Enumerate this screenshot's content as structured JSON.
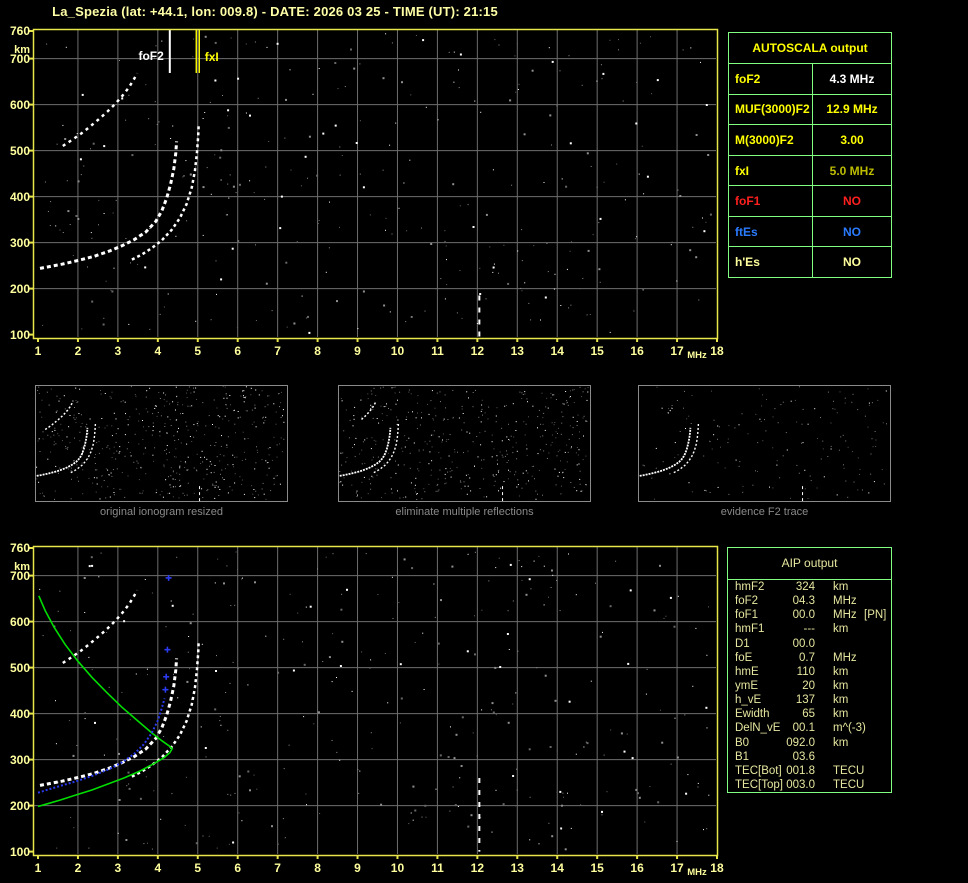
{
  "title": "La_Spezia (lat: +44.1, lon: 009.8) - DATE: 2026 03 25 - TIME (UT): 21:15",
  "colors": {
    "background": "#000000",
    "plot_border": "#e8e64a",
    "grid": "#6e6e6e",
    "axis_text": "#ffff9e",
    "table_border": "#80ff80",
    "trace_white": "#ffffff",
    "model_trace_blue": "#2b3bf0",
    "profile_green": "#00dd00",
    "caption_gray": "#8a8a8a"
  },
  "axes": {
    "x_ticks": [
      "1",
      "2",
      "3",
      "4",
      "5",
      "6",
      "7",
      "8",
      "9",
      "10",
      "11",
      "12",
      "13",
      "14",
      "15",
      "16",
      "17",
      "18"
    ],
    "x_unit": "MHz",
    "y_ticks": [
      "760",
      "700",
      "600",
      "500",
      "400",
      "300",
      "200",
      "100"
    ],
    "y_tick_values": [
      760,
      700,
      600,
      500,
      400,
      300,
      200,
      100
    ],
    "y_unit": "km"
  },
  "autoscala": {
    "header": "AUTOSCALA output",
    "rows": [
      {
        "label": "foF2",
        "value": "4.3 MHz",
        "label_color": "#ffff00",
        "value_color": "#ffffff"
      },
      {
        "label": "MUF(3000)F2",
        "value": "12.9 MHz",
        "label_color": "#ffff00",
        "value_color": "#ffff00"
      },
      {
        "label": "M(3000)F2",
        "value": "3.00",
        "label_color": "#ffff00",
        "value_color": "#ffff00"
      },
      {
        "label": "fxI",
        "value": "5.0 MHz",
        "label_color": "#ffff00",
        "value_color": "#bdbd00"
      },
      {
        "label": "foF1",
        "value": "NO",
        "label_color": "#ff2020",
        "value_color": "#ff2020"
      },
      {
        "label": "ftEs",
        "value": "NO",
        "label_color": "#2b7bff",
        "value_color": "#2b7bff"
      },
      {
        "label": "h'Es",
        "value": "NO",
        "label_color": "#ffff9e",
        "value_color": "#ffff9e"
      }
    ]
  },
  "aip": {
    "header": "AIP output",
    "rows": [
      {
        "label": "hmF2",
        "value": "324",
        "unit": "km",
        "note": ""
      },
      {
        "label": "foF2",
        "value": "04.3",
        "unit": "MHz",
        "note": ""
      },
      {
        "label": "foF1",
        "value": "00.0",
        "unit": "MHz",
        "note": "[PN]"
      },
      {
        "label": "hmF1",
        "value": "---",
        "unit": "km",
        "note": ""
      },
      {
        "label": "D1",
        "value": "00.0",
        "unit": "",
        "note": ""
      },
      {
        "label": "foE",
        "value": "0.7",
        "unit": "MHz",
        "note": ""
      },
      {
        "label": "hmE",
        "value": "110",
        "unit": "km",
        "note": ""
      },
      {
        "label": "ymE",
        "value": "20",
        "unit": "km",
        "note": ""
      },
      {
        "label": "h_vE",
        "value": "137",
        "unit": "km",
        "note": ""
      },
      {
        "label": "Ewidth",
        "value": "65",
        "unit": "km",
        "note": ""
      },
      {
        "label": "DelN_vE",
        "value": "00.1",
        "unit": "m^(-3)",
        "note": ""
      },
      {
        "label": "B0",
        "value": "092.0",
        "unit": "km",
        "note": ""
      },
      {
        "label": "B1",
        "value": "03.6",
        "unit": "",
        "note": ""
      },
      {
        "label": "TEC[Bot]",
        "value": "001.8",
        "unit": "TECU",
        "note": ""
      },
      {
        "label": "TEC[Top]",
        "value": "003.0",
        "unit": "TECU",
        "note": ""
      }
    ]
  },
  "thumbnails": [
    {
      "caption": "original ionogram resized"
    },
    {
      "caption": "eliminate multiple reflections"
    },
    {
      "caption": "evidence F2 trace"
    }
  ],
  "chart_data": [
    {
      "type": "scatter",
      "title": "ionogram (top panel)",
      "xlabel": "MHz",
      "ylabel": "km",
      "xlim": [
        1,
        18
      ],
      "ylim": [
        100,
        760
      ],
      "grid": true,
      "annotations": [
        {
          "label": "foF2",
          "f_mhz": 4.3,
          "color": "#ffffff"
        },
        {
          "label": "fxI",
          "f_mhz": 5.0,
          "color": "#ffff00"
        }
      ],
      "series": [
        {
          "name": "F2 o-mode trace",
          "color": "#ffffff",
          "points": [
            [
              1.05,
              244
            ],
            [
              1.3,
              248
            ],
            [
              1.6,
              253
            ],
            [
              2.0,
              261
            ],
            [
              2.4,
              270
            ],
            [
              2.8,
              282
            ],
            [
              3.1,
              293
            ],
            [
              3.4,
              306
            ],
            [
              3.7,
              323
            ],
            [
              3.95,
              346
            ],
            [
              4.1,
              369
            ],
            [
              4.22,
              396
            ],
            [
              4.32,
              427
            ],
            [
              4.4,
              460
            ],
            [
              4.45,
              495
            ],
            [
              4.47,
              520
            ]
          ]
        },
        {
          "name": "F2 x-mode trace",
          "color": "#ffffff",
          "points": [
            [
              3.35,
              263
            ],
            [
              3.6,
              274
            ],
            [
              3.85,
              288
            ],
            [
              4.1,
              305
            ],
            [
              4.35,
              328
            ],
            [
              4.55,
              353
            ],
            [
              4.72,
              384
            ],
            [
              4.85,
              420
            ],
            [
              4.93,
              457
            ],
            [
              4.98,
              497
            ],
            [
              5.01,
              532
            ],
            [
              5.02,
              553
            ]
          ]
        },
        {
          "name": "second-hop echo",
          "color": "#ffffff",
          "points": [
            [
              1.62,
              510
            ],
            [
              1.85,
              523
            ],
            [
              2.08,
              537
            ],
            [
              2.3,
              552
            ],
            [
              2.52,
              568
            ],
            [
              2.74,
              585
            ],
            [
              2.95,
              603
            ],
            [
              3.12,
              620
            ],
            [
              3.28,
              638
            ],
            [
              3.4,
              655
            ],
            [
              3.48,
              668
            ]
          ]
        }
      ],
      "noise_streak": {
        "f_mhz": 12.05,
        "h_range": [
          95,
          185
        ]
      }
    },
    {
      "type": "scatter",
      "title": "ionogram with AIP model (bottom panel)",
      "xlabel": "MHz",
      "ylabel": "km",
      "xlim": [
        1,
        18
      ],
      "ylim": [
        100,
        760
      ],
      "grid": true,
      "series": [
        {
          "name": "F2 o-mode trace",
          "color": "#ffffff",
          "points": [
            [
              1.05,
              244
            ],
            [
              1.3,
              248
            ],
            [
              1.6,
              253
            ],
            [
              2.0,
              261
            ],
            [
              2.4,
              270
            ],
            [
              2.8,
              282
            ],
            [
              3.1,
              293
            ],
            [
              3.4,
              306
            ],
            [
              3.7,
              323
            ],
            [
              3.95,
              346
            ],
            [
              4.1,
              369
            ],
            [
              4.22,
              396
            ],
            [
              4.32,
              427
            ],
            [
              4.4,
              460
            ],
            [
              4.45,
              495
            ],
            [
              4.47,
              520
            ]
          ]
        },
        {
          "name": "F2 x-mode trace",
          "color": "#ffffff",
          "points": [
            [
              3.35,
              263
            ],
            [
              3.6,
              274
            ],
            [
              3.85,
              288
            ],
            [
              4.1,
              305
            ],
            [
              4.35,
              328
            ],
            [
              4.55,
              353
            ],
            [
              4.72,
              384
            ],
            [
              4.85,
              420
            ],
            [
              4.93,
              457
            ],
            [
              4.98,
              497
            ],
            [
              5.01,
              532
            ],
            [
              5.02,
              553
            ]
          ]
        },
        {
          "name": "second-hop echo",
          "color": "#ffffff",
          "points": [
            [
              1.62,
              510
            ],
            [
              1.85,
              523
            ],
            [
              2.08,
              537
            ],
            [
              2.3,
              552
            ],
            [
              2.52,
              568
            ],
            [
              2.74,
              585
            ],
            [
              2.95,
              603
            ],
            [
              3.12,
              620
            ],
            [
              3.28,
              638
            ],
            [
              3.4,
              655
            ],
            [
              3.48,
              668
            ]
          ]
        },
        {
          "name": "restored o-trace (model)",
          "color": "#2b3bf0",
          "points": [
            [
              1.0,
              228
            ],
            [
              1.3,
              236
            ],
            [
              1.6,
              244
            ],
            [
              2.0,
              254
            ],
            [
              2.4,
              266
            ],
            [
              2.8,
              280
            ],
            [
              3.1,
              294
            ],
            [
              3.4,
              312
            ],
            [
              3.65,
              333
            ],
            [
              3.85,
              358
            ],
            [
              4.0,
              385
            ],
            [
              4.1,
              412
            ],
            [
              4.17,
              433
            ]
          ]
        },
        {
          "name": "restored o-trace sparse markers",
          "color": "#2b3bf0",
          "points": [
            [
              4.19,
              452
            ],
            [
              4.21,
              480
            ],
            [
              4.24,
              539
            ],
            [
              4.27,
              695
            ]
          ]
        },
        {
          "name": "electron density profile N(h)",
          "color": "#00dd00",
          "points": [
            [
              1.02,
              656
            ],
            [
              1.18,
              624
            ],
            [
              1.4,
              588
            ],
            [
              1.68,
              550
            ],
            [
              2.0,
              514
            ],
            [
              2.35,
              479
            ],
            [
              2.72,
              446
            ],
            [
              3.1,
              414
            ],
            [
              3.5,
              384
            ],
            [
              3.85,
              358
            ],
            [
              4.1,
              341
            ],
            [
              4.28,
              330
            ],
            [
              4.36,
              324
            ],
            [
              4.3,
              315
            ],
            [
              4.15,
              304
            ],
            [
              3.9,
              291
            ],
            [
              3.55,
              275
            ],
            [
              3.15,
              260
            ],
            [
              2.75,
              247
            ],
            [
              2.35,
              234
            ],
            [
              1.95,
              223
            ],
            [
              1.55,
              212
            ],
            [
              1.2,
              203
            ],
            [
              1.0,
              198
            ]
          ]
        }
      ],
      "noise_streak": {
        "f_mhz": 12.05,
        "h_range": [
          100,
          260
        ]
      }
    }
  ]
}
